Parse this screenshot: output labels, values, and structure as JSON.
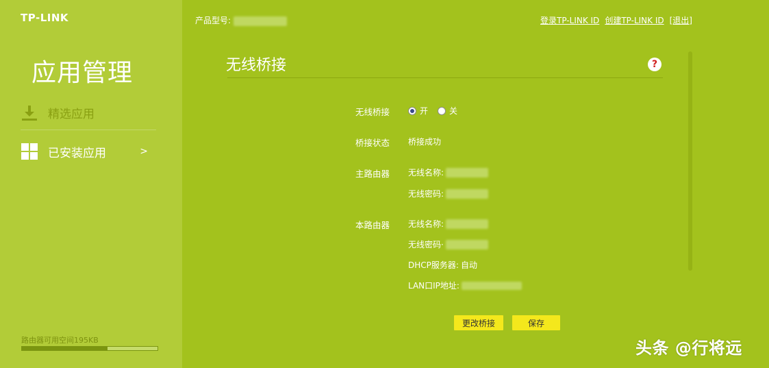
{
  "brand": "TP-LINK",
  "sidebar": {
    "title": "应用管理",
    "items": [
      {
        "label": "精选应用",
        "icon": "download-icon"
      },
      {
        "label": "已安装应用",
        "icon": "grid-icon",
        "arrow": ">"
      }
    ],
    "storage": {
      "label": "路由器可用空间195KB",
      "used_fraction": 0.63
    }
  },
  "topbar": {
    "product_model_label": "产品型号:",
    "links": {
      "login": "登录TP-LINK ID",
      "create": "创建TP-LINK ID",
      "logout": "[退出]"
    }
  },
  "main": {
    "title": "无线桥接",
    "help_icon": "?",
    "bridge": {
      "label": "无线桥接",
      "options": [
        {
          "label": "开",
          "checked": true
        },
        {
          "label": "关",
          "checked": false
        }
      ]
    },
    "status": {
      "label": "桥接状态",
      "value": "桥接成功"
    },
    "main_router": {
      "label": "主路由器",
      "ssid_label": "无线名称:",
      "password_label": "无线密码:"
    },
    "this_router": {
      "label": "本路由器",
      "ssid_label": "无线名称:",
      "password_label": "无线密码·",
      "dhcp_label": "DHCP服务器:",
      "dhcp_value": "自动",
      "lan_ip_label": "LAN口IP地址:"
    },
    "buttons": {
      "change": "更改桥接",
      "save": "保存"
    }
  },
  "watermark": "头条 @行将远",
  "colors": {
    "main_bg": "#a3c21d",
    "sidebar_bg": "#b2cc38",
    "button": "#f4e81c"
  }
}
